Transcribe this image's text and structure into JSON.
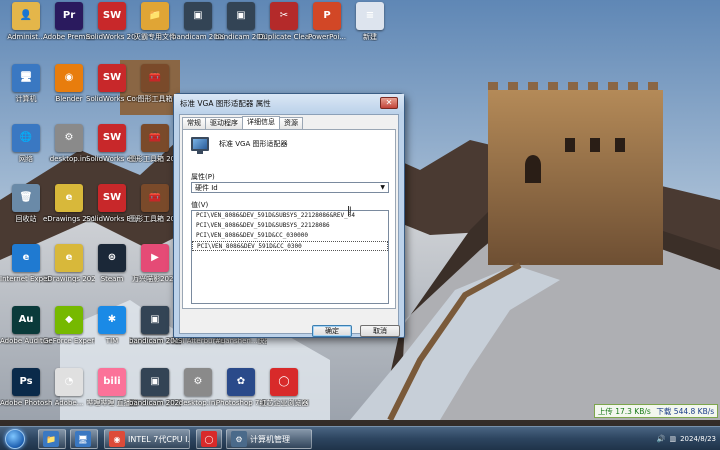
{
  "desktop_icons": [
    {
      "label": "Administ...",
      "icon": "user-folder-icon",
      "color": "#e4b64a",
      "glyph": "👤"
    },
    {
      "label": "Adobe Premie...",
      "icon": "premiere-icon",
      "color": "#2a1a5e",
      "glyph": "Pr"
    },
    {
      "label": "SolidWorks 2014 x64 ...",
      "icon": "solidworks-icon",
      "color": "#c8282a",
      "glyph": "SW"
    },
    {
      "label": "灭霸专用文件",
      "icon": "folder-icon",
      "color": "#e0a535",
      "glyph": "📁"
    },
    {
      "label": "bandicam 2022-12-1...",
      "icon": "bandicam-file-icon",
      "color": "#334455",
      "glyph": "▣"
    },
    {
      "label": "bandicam 2023-04-0...",
      "icon": "bandicam-file-icon",
      "color": "#334455",
      "glyph": "▣"
    },
    {
      "label": "Duplicate Cleaner Pro",
      "icon": "duplicate-cleaner-icon",
      "color": "#b42a2a",
      "glyph": "✂"
    },
    {
      "label": "PowerPoi...",
      "icon": "powerpoint-icon",
      "color": "#d24726",
      "glyph": "P"
    },
    {
      "label": "新建",
      "icon": "document-icon",
      "color": "#dde4ee",
      "glyph": "≡"
    },
    {
      "label": "计算机",
      "icon": "computer-icon",
      "color": "#3a78c2",
      "glyph": "🖥"
    },
    {
      "label": "Blender",
      "icon": "blender-icon",
      "color": "#e87d0d",
      "glyph": "◉"
    },
    {
      "label": "SolidWorks Composer",
      "icon": "solidworks-icon",
      "color": "#c8282a",
      "glyph": "SW"
    },
    {
      "label": "图形工具箱",
      "icon": "toolbox-icon",
      "color": "#7a4a2a",
      "glyph": "🧰"
    },
    {
      "label": "网络",
      "icon": "network-icon",
      "color": "#3a78c2",
      "glyph": "🌐"
    },
    {
      "label": "desktop.ini",
      "icon": "ini-file-icon",
      "color": "#8a8a8a",
      "glyph": "⚙"
    },
    {
      "label": "SolidWorks eDrawings",
      "icon": "solidworks-icon",
      "color": "#c8282a",
      "glyph": "SW"
    },
    {
      "label": "图形工具箱 2022",
      "icon": "toolbox-icon",
      "color": "#7a4a2a",
      "glyph": "🧰"
    },
    {
      "label": "回收站",
      "icon": "recycle-bin-icon",
      "color": "#6a8aa8",
      "glyph": "🗑"
    },
    {
      "label": "eDrawings 2014 x64",
      "icon": "edrawings-icon",
      "color": "#d8b83a",
      "glyph": "e"
    },
    {
      "label": "SolidWorks Explorer",
      "icon": "solidworks-icon",
      "color": "#c8282a",
      "glyph": "SW"
    },
    {
      "label": "图形工具箱 2023",
      "icon": "toolbox-icon",
      "color": "#7a4a2a",
      "glyph": "🧰"
    },
    {
      "label": "Internet Explorer",
      "icon": "ie-icon",
      "color": "#1f7ad1",
      "glyph": "e"
    },
    {
      "label": "eDrawings 2022",
      "icon": "edrawings-icon",
      "color": "#d8b83a",
      "glyph": "e"
    },
    {
      "label": "Steam",
      "icon": "steam-icon",
      "color": "#1b2838",
      "glyph": "⊛"
    },
    {
      "label": "万兴喵影2023",
      "icon": "wondershare-icon",
      "color": "#e54b76",
      "glyph": "▶"
    },
    {
      "label": "Adobe Audition",
      "icon": "audition-icon",
      "color": "#0a3a3a",
      "glyph": "Au"
    },
    {
      "label": "GeForce Experience",
      "icon": "geforce-icon",
      "color": "#76b900",
      "glyph": "◆"
    },
    {
      "label": "TIM",
      "icon": "tim-icon",
      "color": "#1a8ae6",
      "glyph": "✱"
    },
    {
      "label": "bandicam 2022-12-1...",
      "icon": "bandicam-file-icon",
      "color": "#334455",
      "glyph": "▣"
    },
    {
      "label": "bandicam 2023-04-0...",
      "icon": "bandicam-file-icon",
      "color": "#334455",
      "glyph": "▣"
    },
    {
      "label": "MSI Afterburner",
      "icon": "afterburner-icon",
      "color": "#7a1a1a",
      "glyph": "✈"
    },
    {
      "label": "#uanshen...快捷方式",
      "icon": "shortcut-icon",
      "color": "#4a4a6a",
      "glyph": "⇱"
    },
    {
      "label": "Adobe Photosh...",
      "icon": "photoshop-icon",
      "color": "#0a2a4a",
      "glyph": "Ps"
    },
    {
      "label": "Adobe...",
      "icon": "lightroom-icon",
      "color": "#e0e0e0",
      "glyph": "◔"
    },
    {
      "label": "哔哩哔哩 直播姬",
      "icon": "bilibili-icon",
      "color": "#fb7299",
      "glyph": "bili"
    },
    {
      "label": "bandicam 2022-12-1...",
      "icon": "bandicam-file-icon",
      "color": "#334455",
      "glyph": "▣"
    },
    {
      "label": "bandicam 2023-04-0...",
      "icon": "bandicam-file-icon",
      "color": "#334455",
      "glyph": "▣"
    },
    {
      "label": "desktop.ini",
      "icon": "ini-file-icon",
      "color": "#8a8a8a",
      "glyph": "⚙"
    },
    {
      "label": "Photoshop 7.0",
      "icon": "photoshop7-icon",
      "color": "#2a4a8a",
      "glyph": "✿"
    },
    {
      "label": "红芯企业浏览器",
      "icon": "browser-icon",
      "color": "#d82a2a",
      "glyph": "◯"
    }
  ],
  "dialog": {
    "title": "标准 VGA 图形适配器 属性",
    "close": "✕",
    "tabs": [
      "常规",
      "驱动程序",
      "详细信息",
      "资源"
    ],
    "active_tab": 2,
    "device_name": "标准 VGA 图形适配器",
    "property_label": "属性(P)",
    "property_value": "硬件 Id",
    "value_label": "值(V)",
    "values": [
      "PCI\\VEN_8086&DEV_591D&SUBSYS_22128086&REV_04",
      "PCI\\VEN_8086&DEV_591D&SUBSYS_22128086",
      "PCI\\VEN_8086&DEV_591D&CC_030000",
      "PCI\\VEN_8086&DEV_591D&CC_0300"
    ],
    "ok": "确定",
    "cancel": "取消"
  },
  "taskbar": {
    "items": [
      {
        "label": "",
        "icon": "explorer-icon",
        "color": "#3a78c2",
        "glyph": "📁"
      },
      {
        "label": "",
        "icon": "computer-icon",
        "color": "#3a78c2",
        "glyph": "🖥"
      },
      {
        "label": "INTEL 7代CPU I...",
        "icon": "chrome-icon",
        "color": "#dd4b39",
        "glyph": "◉"
      },
      {
        "label": "",
        "icon": "browser-icon",
        "color": "#d82a2a",
        "glyph": "◯"
      },
      {
        "label": "计算机管理",
        "icon": "computer-management-icon",
        "color": "#4a6a8a",
        "glyph": "⚙"
      }
    ],
    "net_up": "上传 17.3 KB/s",
    "net_down": "下载 544.8 KB/s",
    "date": "2024/8/23"
  }
}
